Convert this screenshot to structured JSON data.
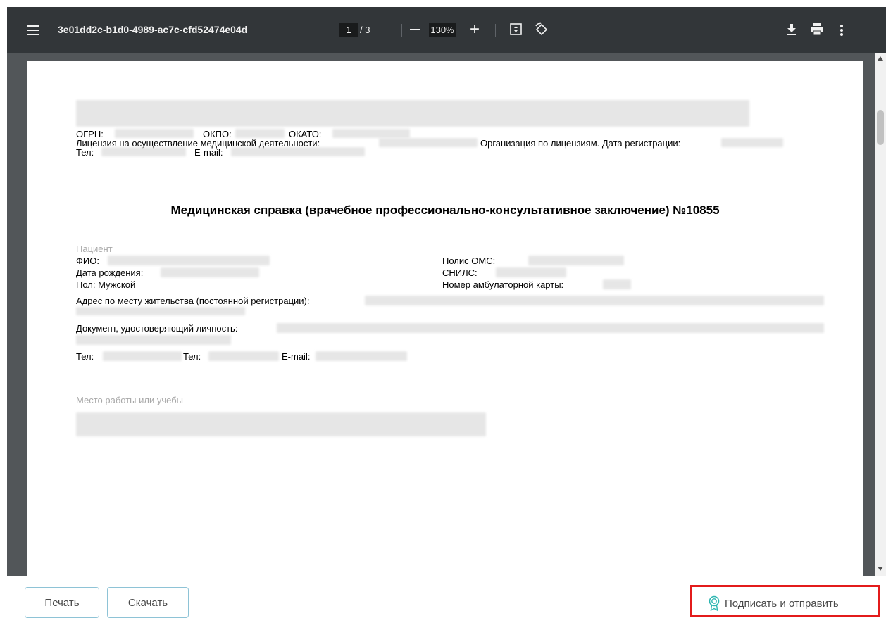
{
  "viewer": {
    "title": "3e01dd2c-b1d0-4989-ac7c-cfd52474e04d",
    "page_current": "1",
    "page_total": "/ 3",
    "zoom": "130%",
    "zoom_in_glyph": "+",
    "icons": [
      "menu-icon",
      "zoom-out-icon",
      "zoom-in-icon",
      "fit-page-icon",
      "rotate-icon",
      "download-icon",
      "print-icon",
      "more-vert-icon"
    ],
    "toolbar_color": "#323639",
    "background_color": "#525659"
  },
  "document": {
    "ogrn_label": "ОГРН:",
    "okpo_label": "ОКПО:",
    "okato_label": "ОКАТО:",
    "license_label": "Лицензия на осуществление медицинской деятельности:",
    "license_org_label": "Организация по лицензиям. Дата регистрации:",
    "phone_label": "Тел:",
    "email_label": "E-mail:",
    "heading": "Медицинская справка (врачебное профессионально-консультативное заключение) №10855",
    "patient_section": "Пациент",
    "fio_label": "ФИО:",
    "dob_label": "Дата рождения:",
    "sex": "Пол: Мужской",
    "oms_label": "Полис ОМС:",
    "snils_label": "СНИЛС:",
    "card_label": "Номер амбулаторной карты:",
    "address_label": "Адрес по месту жительства (постоянной регистрации):",
    "id_doc_label": "Документ, удостоверяющий личность:",
    "phone2_label": "Тел:",
    "phone3_label": "Тел:",
    "email2_label": "E-mail:",
    "work_section": "Место работы или учебы"
  },
  "footer": {
    "print_label": "Печать",
    "download_label": "Скачать",
    "sign_label": "Подписать и отправить",
    "sign_icon": "certificate-icon",
    "highlight_color": "#e31b1b",
    "button_border_color": "#8ec3d6"
  }
}
